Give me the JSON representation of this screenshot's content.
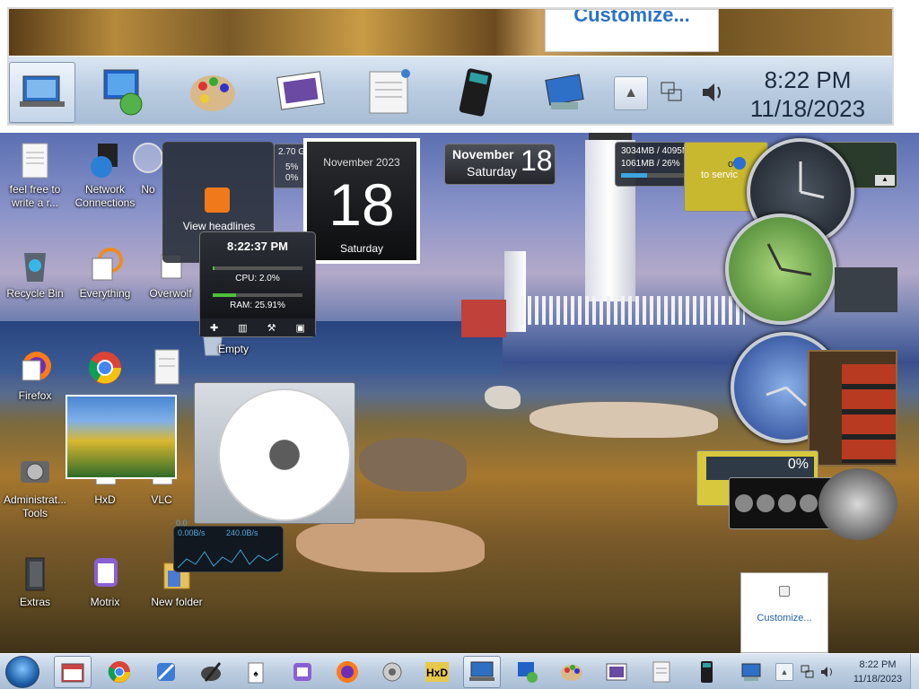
{
  "zoom_preview": {
    "customize_label": "Customize...",
    "clock_time": "8:22 PM",
    "clock_date": "11/18/2023",
    "tray_up_glyph": "▲",
    "icons": [
      "remote-desktop-icon",
      "network-computer-icon",
      "paint-palette-icon",
      "photo-viewer-icon",
      "notepad-icon",
      "calculator-icon",
      "network-tray-icon",
      "speaker-icon"
    ]
  },
  "desktop_icons": [
    {
      "label": "feel free to write a r...",
      "icon": "text-document-icon"
    },
    {
      "label": "Network Connections",
      "icon": "network-globe-icon"
    },
    {
      "label": "No",
      "icon": "search-magnifier-icon"
    },
    {
      "label": "Recycle Bin",
      "icon": "recycle-bin-icon"
    },
    {
      "label": "Everything",
      "icon": "everything-search-icon"
    },
    {
      "label": "Overwolf",
      "icon": "overwolf-icon"
    },
    {
      "label": "Firefox",
      "icon": "firefox-icon"
    },
    {
      "label": "Empty",
      "icon": "empty-trash-icon"
    },
    {
      "label": "Administrat... Tools",
      "icon": "admin-tools-icon"
    },
    {
      "label": "HxD",
      "icon": "hex-editor-icon"
    },
    {
      "label": "VLC",
      "icon": "vlc-icon"
    },
    {
      "label": "Extras",
      "icon": "book-folder-icon"
    },
    {
      "label": "Motrix",
      "icon": "motrix-icon"
    },
    {
      "label": "New folder",
      "icon": "folder-icon"
    }
  ],
  "gadgets": {
    "feed": {
      "label": "View headlines"
    },
    "cpu_speed": {
      "freq": "2.70 GHz",
      "core1": "5%",
      "core2": "0%"
    },
    "calendar": {
      "month_year": "November 2023",
      "day": "18",
      "weekday": "Saturday"
    },
    "date_strip": {
      "month": "November",
      "weekday": "Saturday",
      "day": "18"
    },
    "memory": {
      "line1": "3034MB / 4095MB",
      "line2": "1061MB / 26%",
      "usage": 0.26
    },
    "system_time": {
      "time": "8:22:37 PM",
      "cpu": "CPU: 2.0%",
      "ram": "RAM: 25.91%",
      "cpu_level": 0.02,
      "ram_level": 0.2591
    },
    "network": {
      "down": "0.00B/s",
      "up": "240.0B/s",
      "small": "0.0"
    },
    "info_banner": {
      "text": "ot e",
      "text2": "to servic"
    },
    "percent_gadget": {
      "value": "0%"
    },
    "popup": {
      "customize": "Customize..."
    }
  },
  "taskbar": {
    "clock_time": "8:22 PM",
    "clock_date": "11/18/2023",
    "tray_up_glyph": "▲",
    "buttons": [
      "calendar-gadget-icon",
      "chrome-icon",
      "xcode-tools-icon",
      "paint-brush-icon",
      "solitaire-cards-icon",
      "motrix-icon",
      "firefox-icon",
      "settings-gear-icon",
      "hxd-icon",
      "remote-desktop-icon",
      "network-computer-icon",
      "paint-palette-icon",
      "photo-viewer-icon",
      "notepad-icon",
      "calculator-icon",
      "network-tray-icon"
    ]
  }
}
